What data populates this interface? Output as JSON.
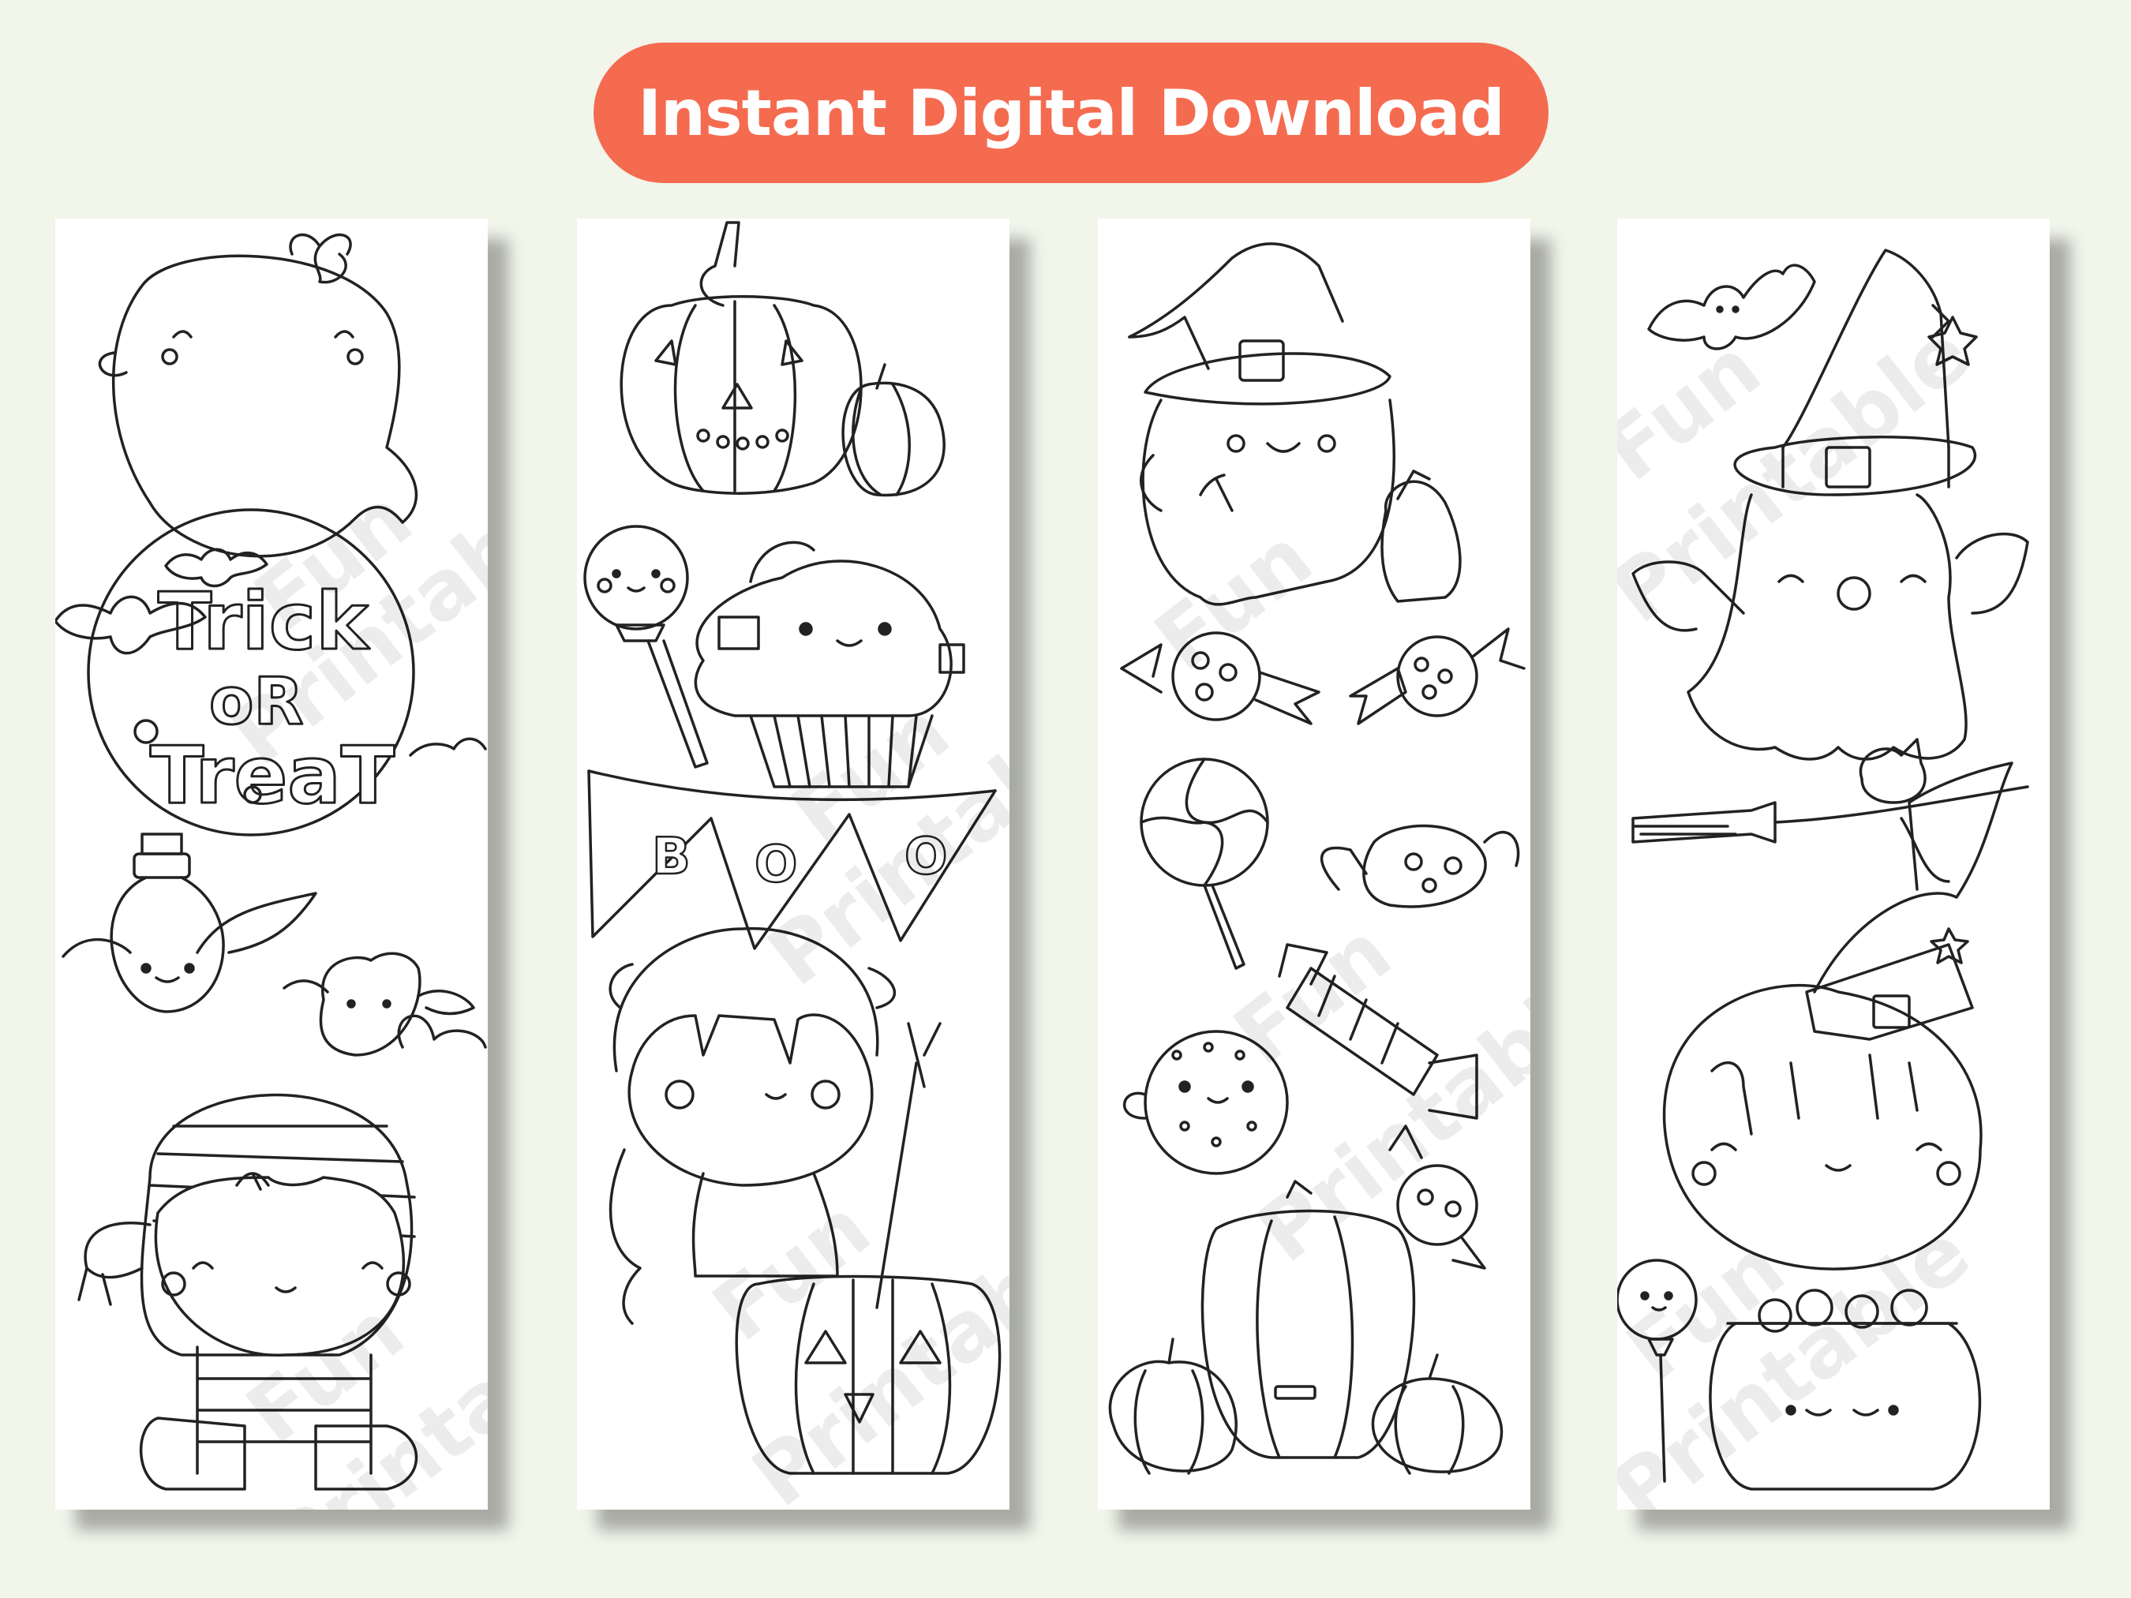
{
  "banner": {
    "title": "Instant Digital Download",
    "color": "#f56b50"
  },
  "bookmarks": [
    {
      "theme": "ghost-trick-or-treat-mummy",
      "lettering": "Trick oR TreaT"
    },
    {
      "theme": "pumpkin-cupcake-boo-devil",
      "lettering": "BOO"
    },
    {
      "theme": "ghost-witch-hat-candies-pumpkins"
    },
    {
      "theme": "witch-ghost-broom-witch-girl"
    }
  ],
  "watermark": {
    "line1": "Fun",
    "line2": "Printable"
  }
}
